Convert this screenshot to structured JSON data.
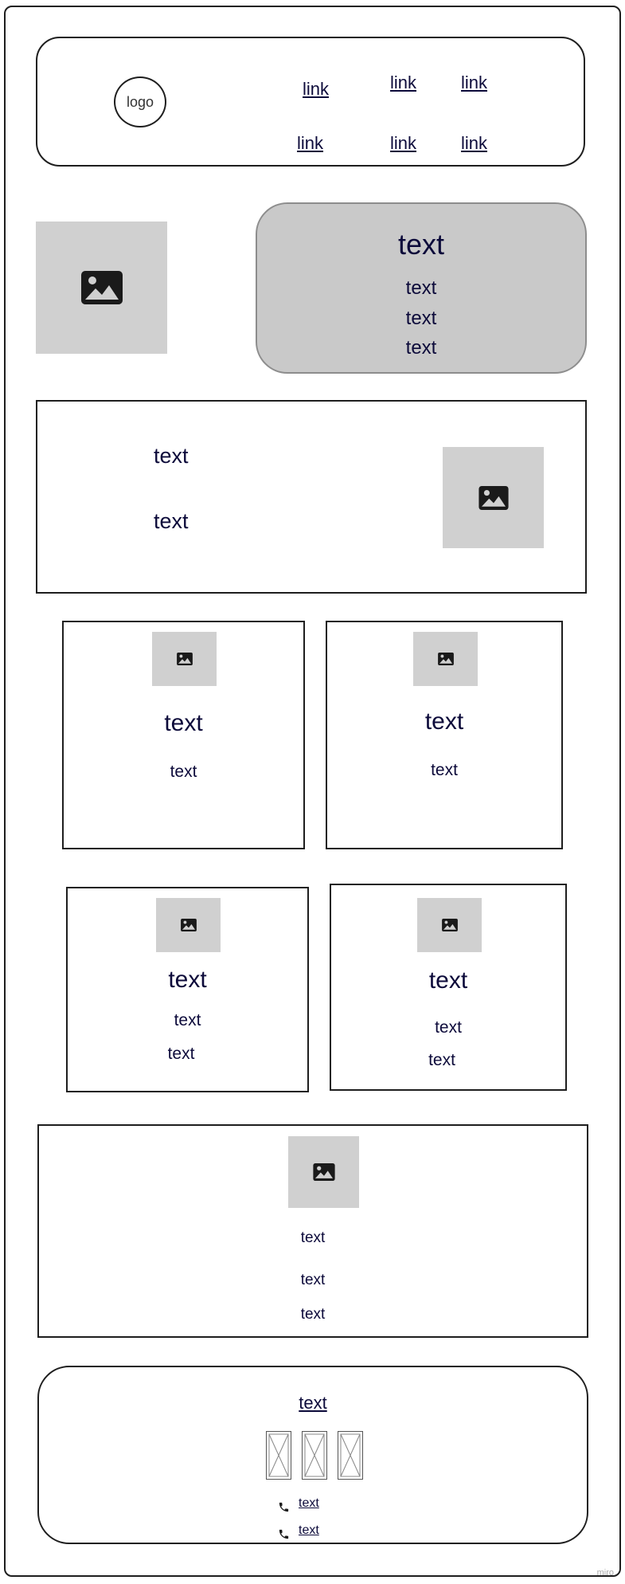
{
  "header": {
    "logo": "logo",
    "links": [
      "link",
      "link",
      "link",
      "link",
      "link",
      "link"
    ]
  },
  "hero": {
    "title": "text",
    "lines": [
      "text",
      "text",
      "text"
    ]
  },
  "feature": {
    "lines": [
      "text",
      "text"
    ]
  },
  "cards": [
    {
      "title": "text",
      "lines": [
        "text"
      ]
    },
    {
      "title": "text",
      "lines": [
        "text"
      ]
    },
    {
      "title": "text",
      "lines": [
        "text",
        "text"
      ]
    },
    {
      "title": "text",
      "lines": [
        "text",
        "text"
      ]
    }
  ],
  "wide_section": {
    "lines": [
      "text",
      "text",
      "text"
    ]
  },
  "footer": {
    "title_link": "text",
    "contacts": [
      "text",
      "text"
    ]
  },
  "watermark": "miro",
  "icons": {
    "image": "image-icon",
    "phone": "phone-icon",
    "placeholder": "placeholder-x-icon"
  },
  "colors": {
    "placeholder_bg": "#d0d0d0",
    "hero_bg": "#c9c9c9",
    "text": "#0c0a3a",
    "border": "#1e1e1e"
  }
}
